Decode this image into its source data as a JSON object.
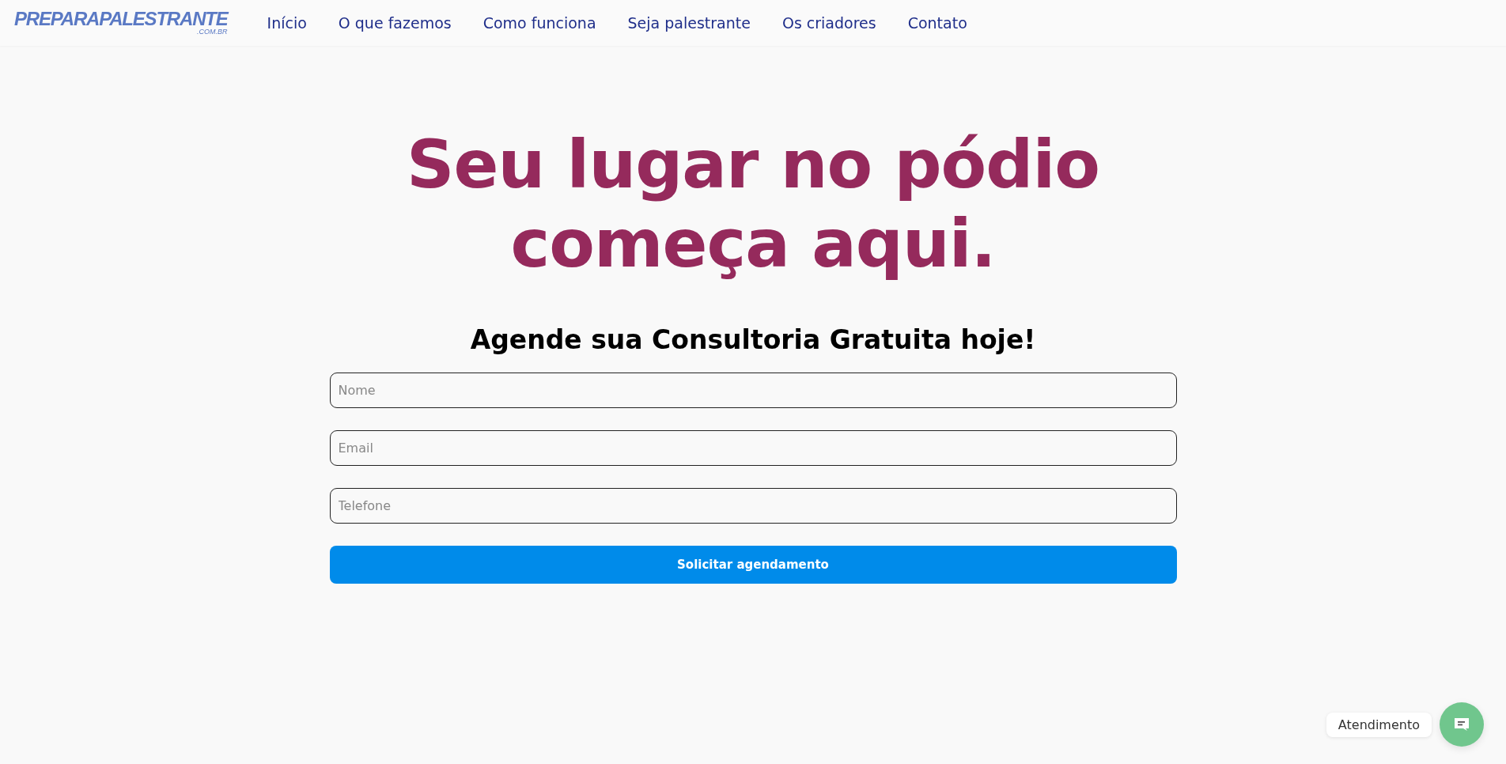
{
  "header": {
    "logo": {
      "name": "PREPARAPALESTRANTE",
      "domain": ".COM.BR"
    },
    "nav": [
      {
        "label": "Início"
      },
      {
        "label": "O que fazemos"
      },
      {
        "label": "Como funciona"
      },
      {
        "label": "Seja palestrante"
      },
      {
        "label": "Os criadores"
      },
      {
        "label": "Contato"
      }
    ]
  },
  "hero": {
    "title_lines": [
      "Seu lugar no pódio",
      "começa aqui."
    ]
  },
  "form": {
    "heading": "Agende sua Consultoria Gratuita hoje!",
    "fields": [
      {
        "placeholder": "Nome"
      },
      {
        "placeholder": "Email"
      },
      {
        "placeholder": "Telefone"
      }
    ],
    "submit": "Solicitar agendamento"
  },
  "chat_widget": {
    "label": "Atendimento"
  }
}
